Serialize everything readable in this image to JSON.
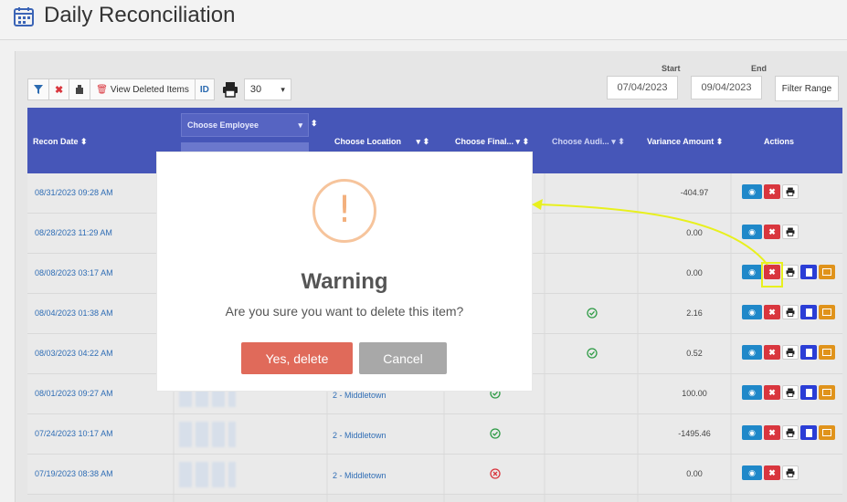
{
  "header": {
    "title": "Daily Reconciliation",
    "icon": "calendar-icon"
  },
  "toolbar": {
    "view_deleted_label": "View Deleted Items",
    "id_label": "ID",
    "page_size": "30"
  },
  "date_range": {
    "start_label": "Start",
    "start_value": "07/04/2023",
    "end_label": "End",
    "end_value": "09/04/2023",
    "filter_label": "Filter Range"
  },
  "table": {
    "columns": {
      "recon_date": "Recon Date",
      "employee": "Choose Employee",
      "location": "Choose Location",
      "final": "Choose Final...",
      "audit": "Choose Audi...",
      "variance": "Variance Amount",
      "actions": "Actions"
    },
    "rows": [
      {
        "date": "08/31/2023 09:28 AM",
        "location": "",
        "status": "",
        "audit": "",
        "variance": "-404.97",
        "actions": [
          "view",
          "delete",
          "print"
        ]
      },
      {
        "date": "08/28/2023 11:29 AM",
        "location": "",
        "status": "",
        "audit": "",
        "variance": "0.00",
        "actions": [
          "view",
          "delete",
          "print"
        ]
      },
      {
        "date": "08/08/2023 03:17 AM",
        "location": "",
        "status": "",
        "audit": "",
        "variance": "0.00",
        "actions": [
          "view",
          "delete",
          "print",
          "doc",
          "folder"
        ]
      },
      {
        "date": "08/04/2023 01:38 AM",
        "location": "",
        "status": "",
        "audit": "check",
        "variance": "2.16",
        "actions": [
          "view",
          "delete",
          "print",
          "doc",
          "folder"
        ]
      },
      {
        "date": "08/03/2023 04:22 AM",
        "location": "",
        "status": "",
        "audit": "check",
        "variance": "0.52",
        "actions": [
          "view",
          "delete",
          "print",
          "doc",
          "folder"
        ]
      },
      {
        "date": "08/01/2023 09:27 AM",
        "location": "2 - Middletown",
        "status": "check",
        "audit": "",
        "variance": "100.00",
        "actions": [
          "view",
          "delete",
          "print",
          "doc",
          "folder"
        ]
      },
      {
        "date": "07/24/2023 10:17 AM",
        "location": "2 - Middletown",
        "status": "check",
        "audit": "",
        "variance": "-1495.46",
        "actions": [
          "view",
          "delete",
          "print",
          "doc",
          "folder"
        ]
      },
      {
        "date": "07/19/2023 08:38 AM",
        "location": "2 - Middletown",
        "status": "x",
        "audit": "",
        "variance": "0.00",
        "actions": [
          "view",
          "delete",
          "print"
        ]
      }
    ]
  },
  "modal": {
    "title": "Warning",
    "message": "Are you sure you want to delete this item?",
    "confirm_label": "Yes, delete",
    "cancel_label": "Cancel"
  },
  "colors": {
    "header_bg": "#4656b8",
    "link": "#2f6db5",
    "confirm": "#e06a5a",
    "cancel": "#a8a8a8",
    "warning": "#f3b07d",
    "annotation": "#e8f01e"
  }
}
